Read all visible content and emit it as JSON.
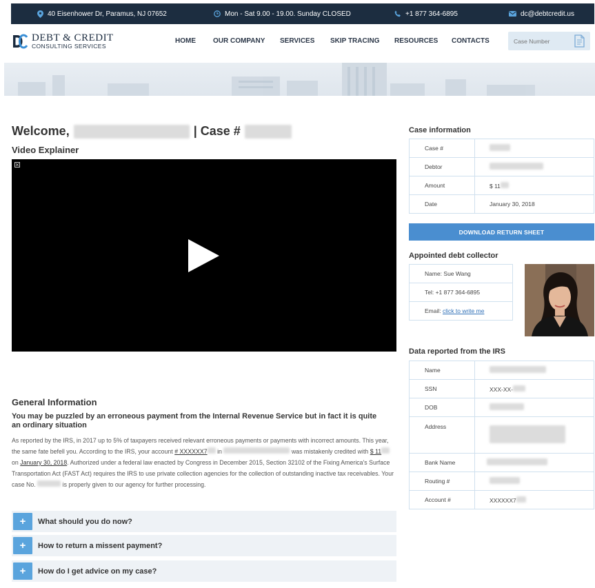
{
  "topbar": {
    "address": "40 Eisenhower Dr, Paramus, NJ 07652",
    "hours": "Mon - Sat 9.00 - 19.00. Sunday CLOSED",
    "phone": "+1 877 364-6895",
    "email": "dc@debtcredit.us"
  },
  "brand": {
    "line1": "DEBT & CREDIT",
    "line2": "CONSULTING SERVICES"
  },
  "nav": {
    "home": "HOME",
    "company": "OUR COMPANY",
    "services": "SERVICES",
    "skip": "SKIP TRACING",
    "resources": "RESOURCES",
    "contacts": "CONTACTS"
  },
  "search": {
    "placeholder": "Case Number"
  },
  "welcome": {
    "prefix": "Welcome,",
    "sep": "| Case #"
  },
  "video": {
    "title": "Video Explainer"
  },
  "general": {
    "title": "General Information",
    "subtitle": "You may be puzzled by an erroneous payment from the Internal Revenue Service but in fact it is quite an ordinary situation",
    "p1": "As reported by the IRS, in 2017 up to 5% of taxpayers received relevant erroneous payments or payments with incorrect amounts. This year, the same fate befell you. According to the IRS, your account ",
    "account": "# XXXXXX7",
    "p2": " in ",
    "p3": " was mistakenly credited with ",
    "amount": "$ 11",
    "p4": " on ",
    "date": "January 30, 2018",
    "p5": ". Authorized under a federal law enacted by Congress in December 2015, Section 32102 of the Fixing America's Surface Transportation Act (FAST Act) requires the IRS to use private collection agencies for the collection of outstanding inactive tax receivables. Your case No. ",
    "p6": " is properly given to our agency for further processing."
  },
  "accordion": [
    {
      "label": "What should you do now?"
    },
    {
      "label": "How to return a missent payment?"
    },
    {
      "label": "How do I get advice on my case?"
    }
  ],
  "case_info": {
    "title": "Case information",
    "rows": [
      {
        "k": "Case #",
        "v": ""
      },
      {
        "k": "Debtor",
        "v": ""
      },
      {
        "k": "Amount",
        "v": "$ 11"
      },
      {
        "k": "Date",
        "v": "January 30, 2018"
      }
    ]
  },
  "download": {
    "label": "DOWNLOAD RETURN SHEET"
  },
  "collector": {
    "title": "Appointed debt collector",
    "name": "Name: Sue Wang",
    "tel": "Tel: +1 877 364-6895",
    "email_prefix": "Email: ",
    "email_link": "click to write me"
  },
  "irs": {
    "title": "Data reported from the IRS",
    "rows": [
      {
        "k": "Name",
        "v": ""
      },
      {
        "k": "SSN",
        "v": "XXX-XX-"
      },
      {
        "k": "DOB",
        "v": ""
      },
      {
        "k": "Address",
        "v": ""
      },
      {
        "k": "Bank Name",
        "v": ""
      },
      {
        "k": "Routing #",
        "v": ""
      },
      {
        "k": "Account #",
        "v": "XXXXXX7"
      }
    ]
  }
}
